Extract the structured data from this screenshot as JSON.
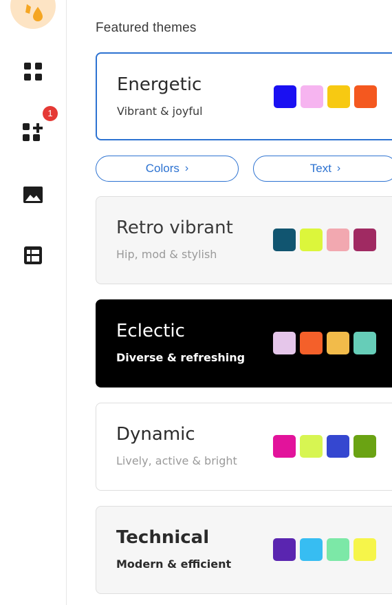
{
  "rail": {
    "notification_count": "1"
  },
  "section_title": "Featured themes",
  "buttons": {
    "colors": "Colors",
    "text": "Text"
  },
  "themes": [
    {
      "name": "Energetic",
      "subtitle": "Vibrant & joyful",
      "selected": true,
      "bg": "#ffffff",
      "name_color": "#2b2b2b",
      "sub_color": "#3a3a3a",
      "swatches": [
        "#1a10f2",
        "#f6b4f0",
        "#f7c912",
        "#f4581f"
      ]
    },
    {
      "name": "Retro vibrant",
      "subtitle": "Hip, mod & stylish",
      "selected": false,
      "bg": "#f6f6f6",
      "name_color": "#3a3a3a",
      "sub_color": "#9a9a9a",
      "swatches": [
        "#115570",
        "#dcf63b",
        "#f2a8b0",
        "#a02a62"
      ]
    },
    {
      "name": "Eclectic",
      "subtitle": "Diverse & refreshing",
      "selected": false,
      "bg": "#000000",
      "name_color": "#ffffff",
      "sub_color": "#ffffff",
      "swatches": [
        "#e5c6ea",
        "#f4602a",
        "#f2bb4a",
        "#66cdb8"
      ]
    },
    {
      "name": "Dynamic",
      "subtitle": "Lively, active & bright",
      "selected": false,
      "bg": "#ffffff",
      "name_color": "#2b2b2b",
      "sub_color": "#9a9a9a",
      "swatches": [
        "#e2139b",
        "#d7f552",
        "#3547d0",
        "#6aa313"
      ]
    },
    {
      "name": "Technical",
      "subtitle": "Modern & efficient",
      "selected": false,
      "bg": "#f6f6f6",
      "name_color": "#2b2b2b",
      "sub_color": "#2b2b2b",
      "swatches": [
        "#5a25b0",
        "#37bdf2",
        "#7ce8a7",
        "#f6f54a"
      ]
    }
  ]
}
